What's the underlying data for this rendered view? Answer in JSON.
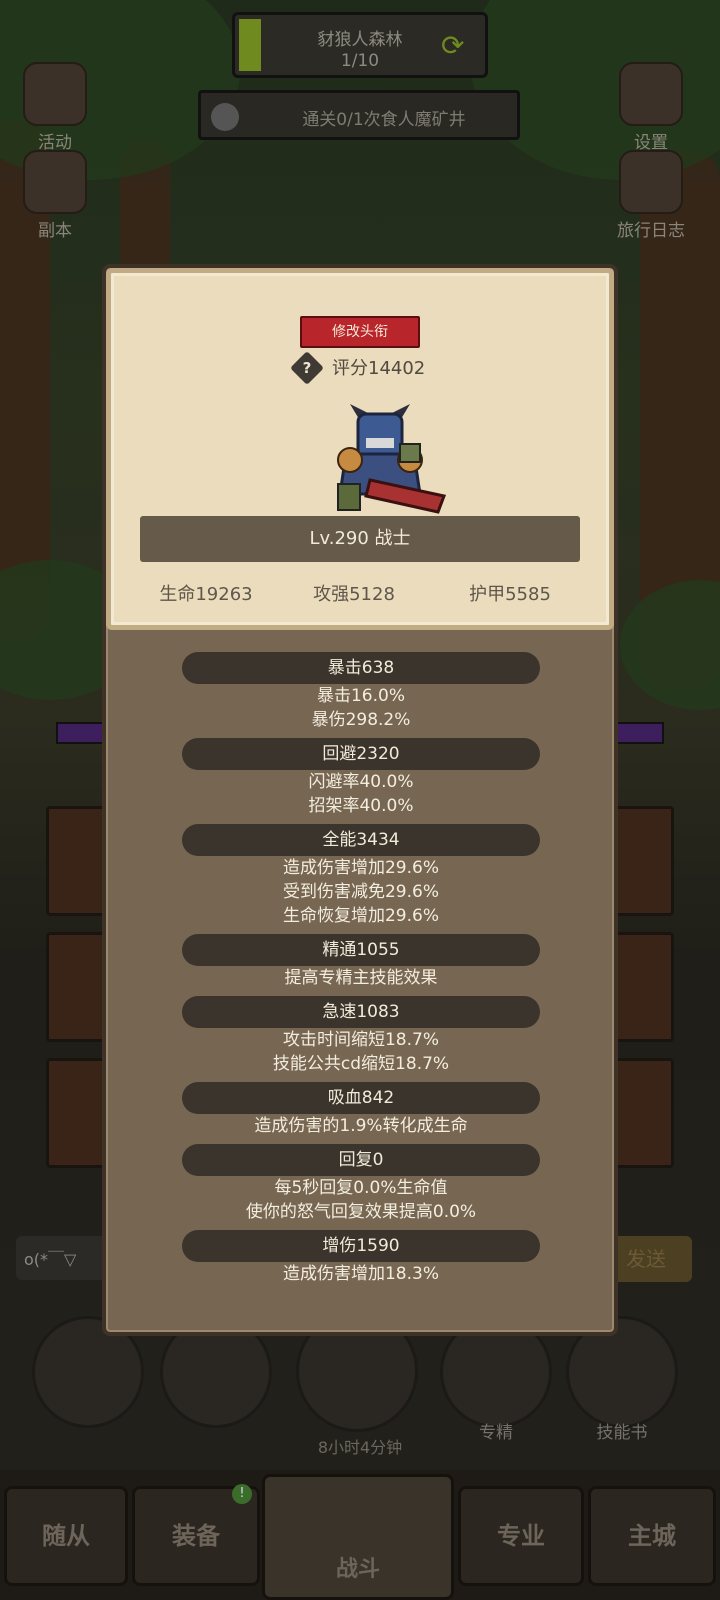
{
  "background": {
    "stage_title": "豺狼人森林",
    "stage_progress_text": "1/10",
    "quest_text": "通关0/1次食人魔矿井",
    "side_left": [
      {
        "label": "活动",
        "icon": "calendar-icon"
      },
      {
        "label": "副本",
        "icon": "portal-icon"
      }
    ],
    "side_right": [
      {
        "label": "设置",
        "icon": "gear-icon"
      },
      {
        "label": "旅行日志",
        "icon": "book-icon"
      }
    ],
    "chat_placeholder": "o(*￣▽",
    "send_label": "发送",
    "timer_text": "8小时4分钟",
    "round_buttons": [
      {
        "label": "",
        "icon": "potion-icon"
      },
      {
        "label": "",
        "icon": "bread-icon"
      },
      {
        "label": "",
        "icon": "chest-icon"
      },
      {
        "label": "专精",
        "icon": "target-icon"
      },
      {
        "label": "技能书",
        "icon": "skill-book-icon"
      }
    ],
    "nav_tabs": [
      {
        "label": "随从"
      },
      {
        "label": "装备"
      },
      {
        "label": "战斗"
      },
      {
        "label": "专业"
      },
      {
        "label": "主城"
      }
    ]
  },
  "profile": {
    "rename_button": "修改头衔",
    "help_icon": "question-icon",
    "score_text": "评分14402",
    "level_class": "Lv.290 战士",
    "hp": "生命19263",
    "attack": "攻强5128",
    "armor": "护甲5585"
  },
  "stats": [
    {
      "title": "暴击638",
      "lines": [
        "暴击16.0%",
        "暴伤298.2%"
      ]
    },
    {
      "title": "回避2320",
      "lines": [
        "闪避率40.0%",
        "招架率40.0%"
      ]
    },
    {
      "title": "全能3434",
      "lines": [
        "造成伤害增加29.6%",
        "受到伤害减免29.6%",
        "生命恢复增加29.6%"
      ]
    },
    {
      "title": "精通1055",
      "lines": [
        "提高专精主技能效果"
      ]
    },
    {
      "title": "急速1083",
      "lines": [
        "攻击时间缩短18.7%",
        "技能公共cd缩短18.7%"
      ]
    },
    {
      "title": "吸血842",
      "lines": [
        "造成伤害的1.9%转化成生命"
      ]
    },
    {
      "title": "回复0",
      "lines": [
        "每5秒回复0.0%生命值",
        "使你的怒气回复效果提高0.0%"
      ]
    },
    {
      "title": "增伤1590",
      "lines": [
        "造成伤害增加18.3%"
      ]
    }
  ],
  "colors": {
    "rename_red": "#b8252a",
    "panel_brown": "#776752",
    "parchment": "#eadcbc"
  }
}
